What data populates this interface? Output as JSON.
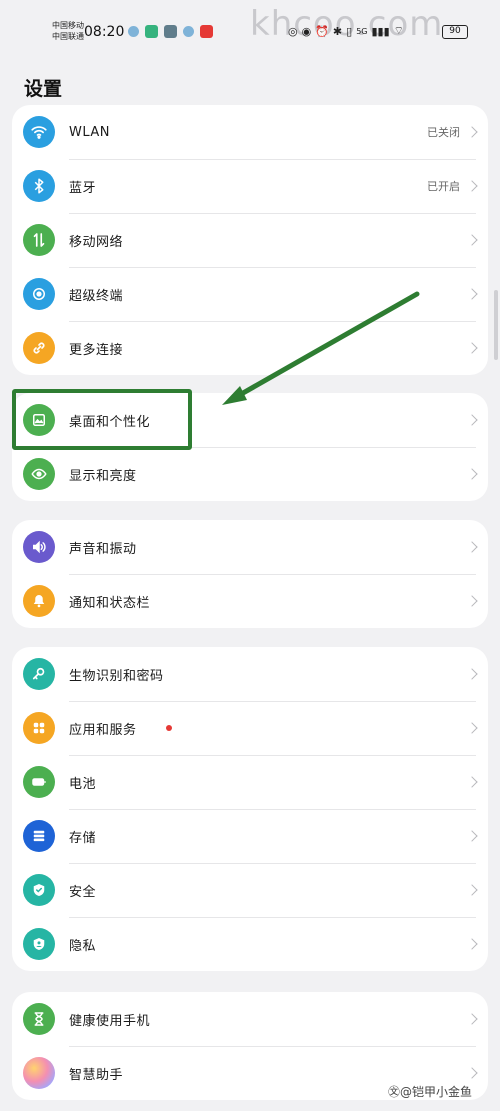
{
  "status_bar": {
    "carrier_1": "中国移动",
    "carrier_2": "中国联通",
    "time": "08:20",
    "network": "5G",
    "battery": "90",
    "watermark": "khcoo.com"
  },
  "title": "设置",
  "groups": [
    {
      "items": [
        {
          "label": "WLAN",
          "value": "已关闭",
          "icon": "wifi-icon",
          "color": "#2a9fe0"
        },
        {
          "label": "蓝牙",
          "value": "已开启",
          "icon": "bluetooth-icon",
          "color": "#2a9fe0"
        },
        {
          "label": "移动网络",
          "value": "",
          "icon": "mobile-data-icon",
          "color": "#4caf50"
        },
        {
          "label": "超级终端",
          "value": "",
          "icon": "super-device-icon",
          "color": "#2a9fe0"
        },
        {
          "label": "更多连接",
          "value": "",
          "icon": "link-icon",
          "color": "#f5a623"
        }
      ]
    },
    {
      "items": [
        {
          "label": "桌面和个性化",
          "value": "",
          "icon": "wallpaper-icon",
          "color": "#4caf50"
        },
        {
          "label": "显示和亮度",
          "value": "",
          "icon": "eye-icon",
          "color": "#4caf50"
        }
      ]
    },
    {
      "items": [
        {
          "label": "声音和振动",
          "value": "",
          "icon": "speaker-icon",
          "color": "#6a5acd"
        },
        {
          "label": "通知和状态栏",
          "value": "",
          "icon": "bell-icon",
          "color": "#f5a623"
        }
      ]
    },
    {
      "items": [
        {
          "label": "生物识别和密码",
          "value": "",
          "icon": "key-icon",
          "color": "#26b5a4"
        },
        {
          "label": "应用和服务",
          "value": "",
          "icon": "apps-icon",
          "color": "#f5a623",
          "badge": true
        },
        {
          "label": "电池",
          "value": "",
          "icon": "battery-icon",
          "color": "#4caf50"
        },
        {
          "label": "存储",
          "value": "",
          "icon": "storage-icon",
          "color": "#1e63d6"
        },
        {
          "label": "安全",
          "value": "",
          "icon": "shield-icon",
          "color": "#26b5a4"
        },
        {
          "label": "隐私",
          "value": "",
          "icon": "privacy-icon",
          "color": "#26b5a4"
        }
      ]
    },
    {
      "items": [
        {
          "label": "健康使用手机",
          "value": "",
          "icon": "hourglass-icon",
          "color": "#4caf50"
        },
        {
          "label": "智慧助手",
          "value": "",
          "icon": "assistant-icon",
          "color": "#c77dde"
        }
      ]
    }
  ],
  "footer_watermark": "㉆@铠甲小金鱼"
}
